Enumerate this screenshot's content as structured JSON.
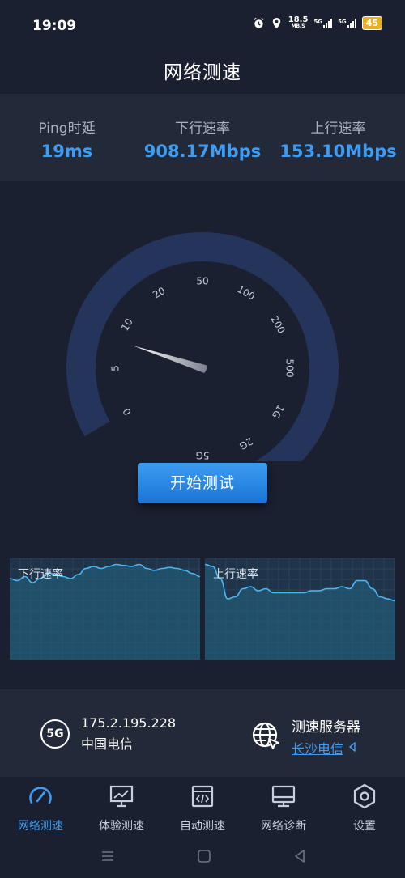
{
  "status_bar": {
    "time": "19:09",
    "net_speed_value": "18.5",
    "net_speed_unit": "MB/S",
    "sim1": "5G",
    "sim2": "5G",
    "battery": "45"
  },
  "header": {
    "title": "网络测速"
  },
  "stats": {
    "ping": {
      "label": "Ping时延",
      "value": "19ms"
    },
    "download": {
      "label": "下行速率",
      "value": "908.17Mbps"
    },
    "upload": {
      "label": "上行速率",
      "value": "153.10Mbps"
    }
  },
  "gauge": {
    "ticks": [
      "0",
      "5",
      "10",
      "20",
      "50",
      "100",
      "200",
      "500",
      "1G",
      "2G",
      "5G"
    ],
    "needle_tick_position": 1.6
  },
  "start_button": {
    "label": "开始测试"
  },
  "charts": {
    "download": {
      "label": "下行速率"
    },
    "upload": {
      "label": "上行速率"
    }
  },
  "chart_data": [
    {
      "type": "area",
      "series": [
        {
          "values": [
            80,
            78,
            82,
            76,
            80,
            86,
            84,
            82,
            80,
            84,
            90,
            92,
            90,
            92,
            94,
            93,
            92,
            94,
            90,
            88,
            90,
            91,
            90,
            88,
            85,
            82
          ]
        }
      ],
      "ylim": [
        0,
        100
      ]
    },
    {
      "type": "area",
      "series": [
        {
          "values": [
            94,
            92,
            80,
            60,
            62,
            70,
            72,
            68,
            70,
            66,
            66,
            66,
            66,
            66,
            68,
            68,
            70,
            70,
            72,
            70,
            78,
            78,
            70,
            62,
            60,
            58
          ]
        }
      ],
      "ylim": [
        0,
        100
      ]
    }
  ],
  "info": {
    "network_badge": "5G",
    "ip": "175.2.195.228",
    "isp": "中国电信",
    "server_title": "测速服务器",
    "server_location": "长沙电信"
  },
  "tabs": [
    {
      "label": "网络测速",
      "icon": "speedometer-icon",
      "active": true
    },
    {
      "label": "体验测速",
      "icon": "monitor-chart-icon",
      "active": false
    },
    {
      "label": "自动测速",
      "icon": "code-window-icon",
      "active": false
    },
    {
      "label": "网络诊断",
      "icon": "desktop-icon",
      "active": false
    },
    {
      "label": "设置",
      "icon": "settings-hexagon-icon",
      "active": false
    }
  ],
  "colors": {
    "background": "#1b2030",
    "panel": "#222938",
    "accent": "#3f9cf2",
    "gauge_track": "#25345a",
    "chart_line": "#4db6f0",
    "chart_fill": "#235a75"
  }
}
